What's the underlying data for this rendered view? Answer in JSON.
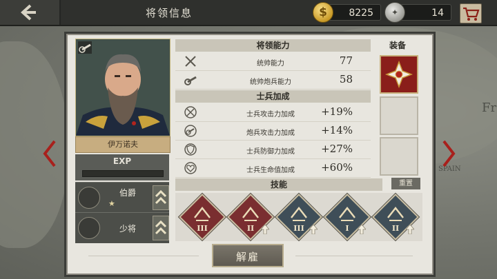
{
  "header": {
    "title": "将领信息",
    "gold": "8225",
    "gold_symbol": "$",
    "medals": "14"
  },
  "general": {
    "name": "伊万诺夫",
    "exp_label": "EXP",
    "exp_progress": 0.0,
    "titles": [
      {
        "label": "伯爵",
        "stars": "★"
      },
      {
        "label": "少将"
      }
    ]
  },
  "abilities": {
    "header": "将领能力",
    "rows": [
      {
        "icon": "crossed-swords-icon",
        "label": "统帅能力",
        "value": "77"
      },
      {
        "icon": "artillery-icon",
        "label": "统帅炮兵能力",
        "value": "58"
      }
    ]
  },
  "soldier_bonus": {
    "header": "士兵加成",
    "rows": [
      {
        "icon": "attack-bonus-icon",
        "label": "士兵攻击力加成",
        "value": "+19%"
      },
      {
        "icon": "artillery-bonus-icon",
        "label": "炮兵攻击力加成",
        "value": "+14%"
      },
      {
        "icon": "defense-bonus-icon",
        "label": "士兵防御力加成",
        "value": "+27%"
      },
      {
        "icon": "health-bonus-icon",
        "label": "士兵生命值加成",
        "value": "+60%"
      }
    ]
  },
  "equipment": {
    "header": "装备",
    "slots": [
      "order-medal",
      "empty",
      "empty"
    ]
  },
  "skills": {
    "header": "技能",
    "reset_label": "重置",
    "items": [
      {
        "icon": "cavalry-arrows-icon",
        "level": "III",
        "color": "#7a2e30"
      },
      {
        "icon": "cannon-icon",
        "level": "II",
        "color": "#7a2e30"
      },
      {
        "icon": "mountain-icon",
        "level": "III",
        "color": "#3f4e58"
      },
      {
        "icon": "tools-icon",
        "level": "I",
        "color": "#3f4e58"
      },
      {
        "icon": "bugle-icon",
        "level": "II",
        "color": "#3f4e58"
      }
    ]
  },
  "actions": {
    "dismiss_label": "解雇"
  },
  "map_labels": {
    "right": "Fr",
    "right_bottom": "SPAIN"
  }
}
